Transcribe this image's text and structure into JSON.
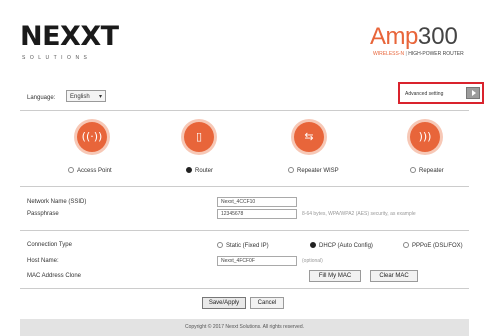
{
  "header": {
    "logo_text": "NEXXT",
    "logo_subtitle": "SOLUTIONS",
    "brand_amp": "Amp",
    "brand_model": "300",
    "brand_tag_left": "WIRELESS-N",
    "brand_tag_right": "HIGH-POWER ROUTER"
  },
  "language": {
    "label": "Language:",
    "selected": "English"
  },
  "advanced": {
    "label": "Advanced setting"
  },
  "modes": [
    {
      "label": "Access Point",
      "selected": false,
      "icon": "access-point-icon"
    },
    {
      "label": "Router",
      "selected": true,
      "icon": "router-icon"
    },
    {
      "label": "Repeater WISP",
      "selected": false,
      "icon": "repeater-wisp-icon"
    },
    {
      "label": "Repeater",
      "selected": false,
      "icon": "repeater-icon"
    }
  ],
  "wireless": {
    "ssid_label": "Network Name (SSID)",
    "ssid_value": "Nexxt_4CCF10",
    "pass_label": "Passphrase",
    "pass_value": "12345678",
    "pass_hint": "8-64 bytes, WPA/WPA2 (AES) security, as example"
  },
  "connection": {
    "type_label": "Connection Type",
    "options": [
      {
        "label": "Static (Fixed IP)",
        "selected": false
      },
      {
        "label": "DHCP (Auto Config)",
        "selected": true
      },
      {
        "label": "PPPoE (DSL/FOX)",
        "selected": false
      }
    ],
    "host_label": "Host Name:",
    "host_value": "Nexxt_4FCF0F",
    "host_hint": "(optional)",
    "mac_label": "MAC Address Clone",
    "fill_mac_button": "Fill My MAC",
    "clear_mac_button": "Clear MAC"
  },
  "actions": {
    "save_label": "Save/Apply",
    "cancel_label": "Cancel"
  },
  "footer": {
    "copyright": "Copyright © 2017 Nexxt Solutions. All rights reserved."
  },
  "colors": {
    "accent": "#e8653a",
    "highlight_border": "#d9232d"
  }
}
